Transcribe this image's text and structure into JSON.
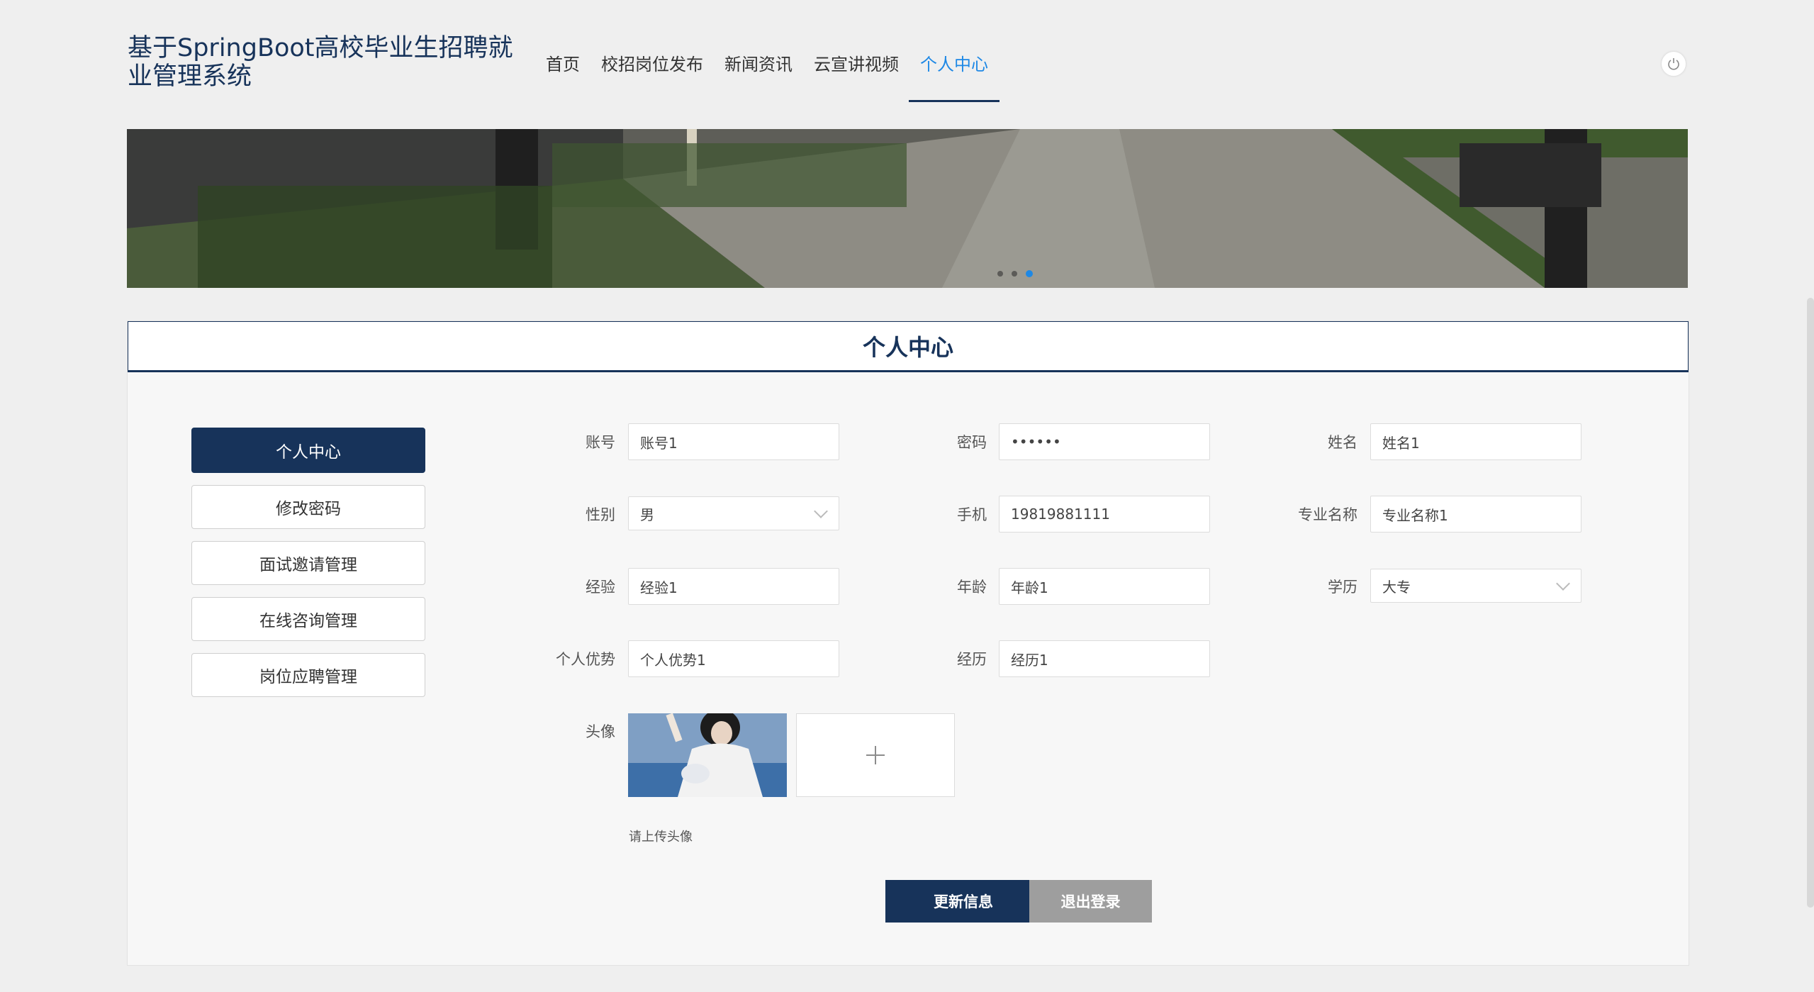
{
  "header": {
    "title": "基于SpringBoot高校毕业生招聘就业管理系统",
    "nav": [
      {
        "label": "首页"
      },
      {
        "label": "校招岗位发布"
      },
      {
        "label": "新闻资讯"
      },
      {
        "label": "云宣讲视频"
      },
      {
        "label": "个人中心",
        "active": true
      }
    ]
  },
  "banner": {
    "slides": 3,
    "active_slide": 3
  },
  "panel": {
    "title": "个人中心",
    "side_menu": [
      {
        "label": "个人中心",
        "active": true
      },
      {
        "label": "修改密码"
      },
      {
        "label": "面试邀请管理"
      },
      {
        "label": "在线咨询管理"
      },
      {
        "label": "岗位应聘管理"
      }
    ],
    "form": {
      "account": {
        "label": "账号",
        "value": "账号1"
      },
      "password": {
        "label": "密码",
        "value": "••••••"
      },
      "name": {
        "label": "姓名",
        "value": "姓名1"
      },
      "gender": {
        "label": "性别",
        "value": "男"
      },
      "phone": {
        "label": "手机",
        "value": "19819881111"
      },
      "major": {
        "label": "专业名称",
        "value": "专业名称1"
      },
      "experience": {
        "label": "经验",
        "value": "经验1"
      },
      "age": {
        "label": "年龄",
        "value": "年龄1"
      },
      "education": {
        "label": "学历",
        "value": "大专"
      },
      "strength": {
        "label": "个人优势",
        "value": "个人优势1"
      },
      "history": {
        "label": "经历",
        "value": "经历1"
      },
      "avatar": {
        "label": "头像",
        "hint": "请上传头像"
      }
    },
    "buttons": {
      "update": "更新信息",
      "logout": "退出登录"
    }
  },
  "colors": {
    "primary": "#17335a",
    "accent": "#1e88e5",
    "secondary_button": "#9e9e9e"
  }
}
